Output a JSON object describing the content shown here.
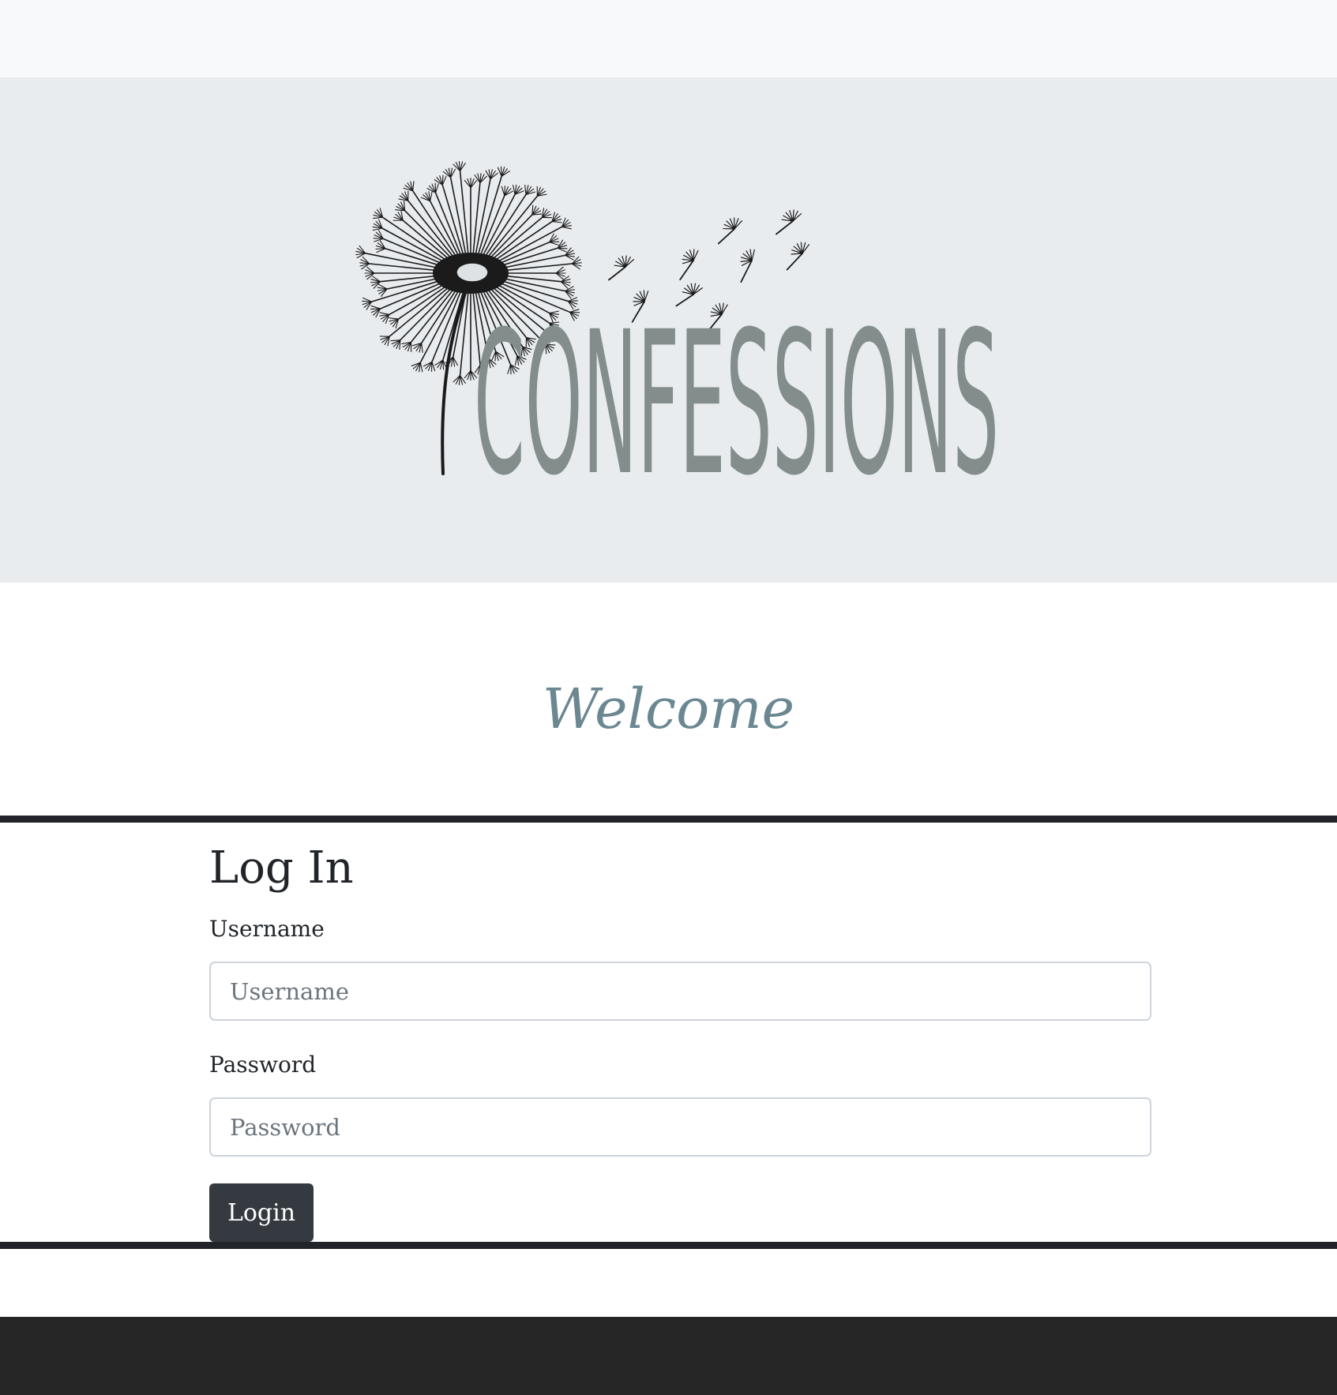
{
  "hero": {
    "logo_text": "CONFESSIONS",
    "logo_icon": "dandelion-icon"
  },
  "welcome": {
    "heading": "Welcome"
  },
  "login": {
    "title": "Log In",
    "username_label": "Username",
    "username_placeholder": "Username",
    "username_value": "",
    "password_label": "Password",
    "password_placeholder": "Password",
    "password_value": "",
    "submit_label": "Login"
  },
  "colors": {
    "topbar": "#f8f9fa",
    "hero_background": "#e9ecef",
    "logo_text": "#838d8c",
    "welcome_text": "#6b8791",
    "rule": "#212529",
    "button": "#343a40",
    "footer": "#262626"
  }
}
